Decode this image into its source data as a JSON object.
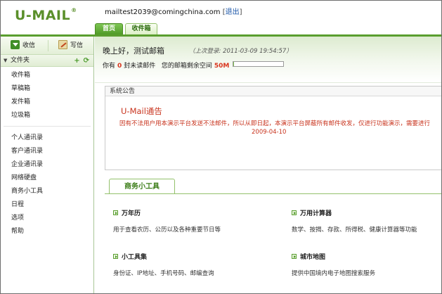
{
  "header": {
    "logo_text": "U-MAIL",
    "logo_mark": "®",
    "user_email": "mailtest2039@comingchina.com",
    "logout_open": "[",
    "logout_label": "退出",
    "logout_close": "]"
  },
  "tabs": [
    {
      "label": "首页",
      "active": true
    },
    {
      "label": "收件箱",
      "active": false
    }
  ],
  "sidebar": {
    "receive_label": "收信",
    "write_label": "写信",
    "folder_header": "文件夹",
    "add_symbol": "+",
    "refresh_symbol": "⟳",
    "folders": [
      "收件箱",
      "草稿箱",
      "发件箱",
      "垃圾箱"
    ],
    "tools": [
      "个人通讯录",
      "客户通讯录",
      "企业通讯录",
      "网络硬盘",
      "商务小工具",
      "日程",
      "选项",
      "帮助"
    ]
  },
  "welcome": {
    "greeting": "晚上好，测试邮箱",
    "last_login": "（上次登录: 2011-03-09 19:54:57）",
    "unread_prefix": "你有",
    "unread_count": "0",
    "unread_suffix": "封未读邮件",
    "space_prefix": "您的邮箱剩余空间",
    "space_value": "50M",
    "quota_used_percent": 2
  },
  "notice": {
    "section_title": "系统公告",
    "title": "U-Mail通告",
    "body": "因有不法用户用本演示平台发送不法邮件，所以从即日起，本演示平台屏蔽所有邮件收发，仅进行功能演示，需要进行",
    "date": "2009-04-10"
  },
  "tools_section": {
    "tab_label": "商务小工具",
    "items": [
      {
        "name": "万年历",
        "desc": "用于查看农历、公历以及各种重要节日等"
      },
      {
        "name": "万用计算器",
        "desc": "数学、按揭、存款、所得税、健康计算器等功能"
      },
      {
        "name": "小工具集",
        "desc": "身份证、IP地址、手机号码、邮编查询"
      },
      {
        "name": "城市地图",
        "desc": "提供中国境内电子地图搜索服务"
      }
    ]
  },
  "colors": {
    "brand_green": "#5a9e2f",
    "alert_red": "#c8331d",
    "link_blue": "#1a55a8"
  }
}
